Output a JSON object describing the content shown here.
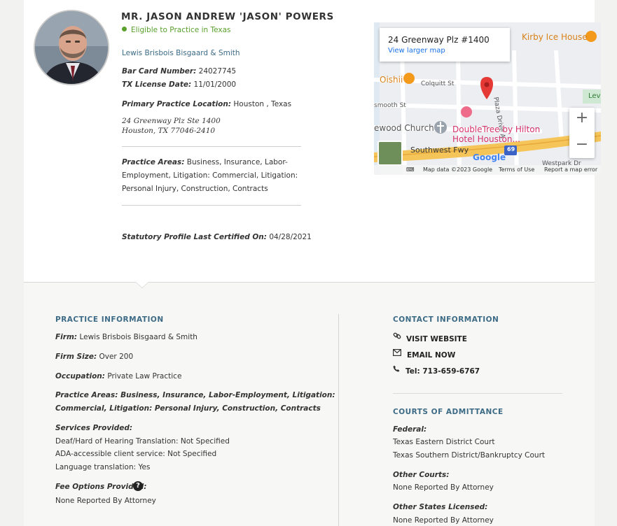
{
  "profile": {
    "name": "MR. JASON ANDREW 'JASON' POWERS",
    "eligibility": "Eligible to Practice in Texas",
    "firm": "Lewis Brisbois Bisgaard & Smith",
    "bar_card_label": "Bar Card Number:",
    "bar_card_value": "24027745",
    "tx_license_label": "TX License Date:",
    "tx_license_value": "11/01/2000",
    "primary_location_label": "Primary Practice Location:",
    "primary_location_value": "Houston , Texas",
    "address_line1": "24 Greenway Plz Ste 1400",
    "address_line2": "Houston, TX 77046-2410",
    "practice_areas_label": "Practice Areas:",
    "practice_areas_line1": "Business, Insurance, Labor-",
    "practice_areas_line2": "Employment, Litigation: Commercial, Litigation:",
    "practice_areas_line3": "Personal Injury, Construction, Contracts",
    "certified_label": "Statutory Profile Last Certified On:",
    "certified_value": "04/28/2021"
  },
  "map": {
    "place_title": "24 Greenway Plz #1400",
    "view_larger": "View larger map",
    "labels": {
      "kirby": "Kirby Ice House",
      "oishii": "Oishii",
      "colquitt": "Colquitt St",
      "smooth": "smooth St",
      "church": "ewood Church",
      "doubletree1": "DoubleTree by Hilton",
      "doubletree2": "Hotel Houston...",
      "fwy": "Southwest Fwy",
      "plaza": "Plaza Drive A",
      "lev": "Lev",
      "westpark": "Westpark Dr",
      "hwy": "69"
    },
    "footer_data": "Map data ©2023 Google",
    "footer_terms": "Terms of Use",
    "footer_report": "Report a map error",
    "google": "Google",
    "zoom_in": "+",
    "zoom_out": "−"
  },
  "practice_info": {
    "title": "PRACTICE INFORMATION",
    "firm_label": "Firm:",
    "firm_value": "Lewis Brisbois Bisgaard & Smith",
    "size_label": "Firm Size:",
    "size_value": "Over 200",
    "occupation_label": "Occupation:",
    "occupation_value": "Private Law Practice",
    "areas_label": "Practice Areas:",
    "areas_line1": "Business, Insurance, Labor-Employment, Litigation:",
    "areas_line2": "Commercial, Litigation: Personal Injury, Construction, Contracts",
    "services_label": "Services Provided:",
    "services": [
      "Deaf/Hard of Hearing Translation: Not Specified",
      "ADA-accessible client service: Not Specified",
      "Language translation: Yes"
    ],
    "fee_label": "Fee Options Provided:",
    "fee_value": "None Reported By Attorney"
  },
  "contact": {
    "title": "CONTACT INFORMATION",
    "website": "VISIT WEBSITE",
    "email": "EMAIL NOW",
    "tel": "Tel: 713-659-6767"
  },
  "courts": {
    "title": "COURTS OF ADMITTANCE",
    "federal_label": "Federal:",
    "federal": [
      "Texas Eastern District Court",
      "Texas Southern District/Bankruptcy Court"
    ],
    "other_label": "Other Courts:",
    "other_value": "None Reported By Attorney",
    "states_label": "Other States Licensed:",
    "states_value": "None Reported By Attorney"
  },
  "colors": {
    "accent": "#3d6b86",
    "eligible": "#5aa02c",
    "map_road": "#f5c55a",
    "map_pin": "#e53935"
  }
}
